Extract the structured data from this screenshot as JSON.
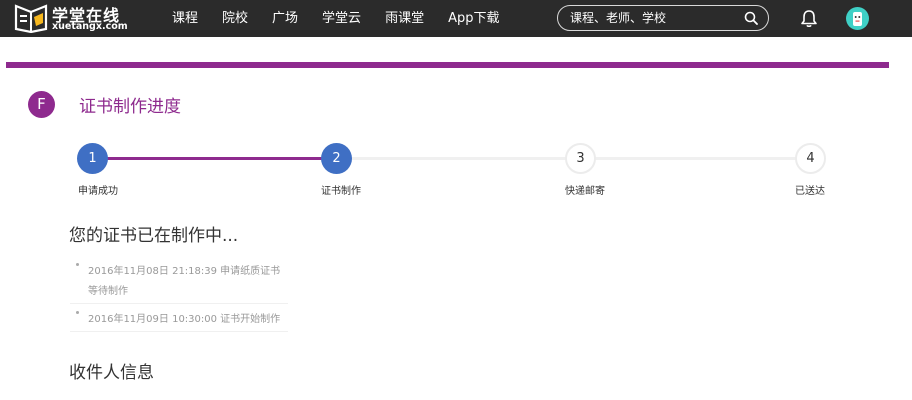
{
  "header": {
    "logo_cn": "学堂在线",
    "logo_en": "xuetangx.com",
    "nav": [
      "课程",
      "院校",
      "广场",
      "学堂云",
      "雨课堂",
      "App下载"
    ],
    "search_placeholder": "课程、老师、学校"
  },
  "colors": {
    "brand_purple": "#8e2a8e",
    "step_blue": "#3f6fc4",
    "nav_bg": "#2b2b2b"
  },
  "page": {
    "badge": "F",
    "title": "证书制作进度"
  },
  "steps": [
    {
      "num": "1",
      "label": "申请成功",
      "state": "done"
    },
    {
      "num": "2",
      "label": "证书制作",
      "state": "current"
    },
    {
      "num": "3",
      "label": "快递邮寄",
      "state": "pending"
    },
    {
      "num": "4",
      "label": "已送达",
      "state": "pending"
    }
  ],
  "status": {
    "title": "您的证书已在制作中...",
    "logs": [
      {
        "line1": "2016年11月08日 21:18:39 申请纸质证书",
        "line2": "等待制作"
      },
      {
        "line1": "2016年11月09日 10:30:00 证书开始制作"
      }
    ]
  },
  "recipient": {
    "title": "收件人信息"
  }
}
